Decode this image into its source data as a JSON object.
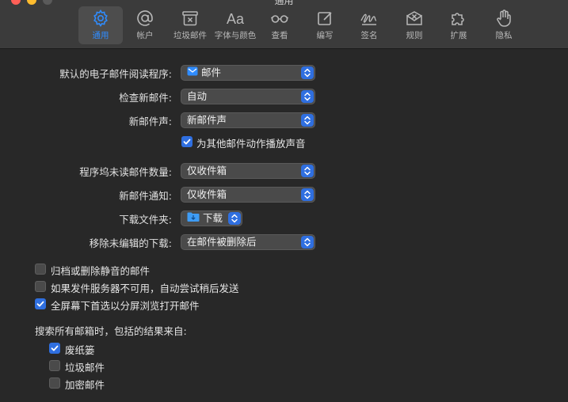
{
  "window": {
    "title": "通用"
  },
  "toolbar": {
    "tabs": [
      {
        "label": "通用",
        "icon": "gear-icon",
        "selected": true
      },
      {
        "label": "帐户",
        "icon": "at-sign-icon"
      },
      {
        "label": "垃圾邮件",
        "icon": "junk-mail-icon"
      },
      {
        "label": "字体与颜色",
        "icon": "fonts-icon",
        "glyph": "Aa"
      },
      {
        "label": "查看",
        "icon": "glasses-icon"
      },
      {
        "label": "编写",
        "icon": "compose-icon"
      },
      {
        "label": "签名",
        "icon": "signature-icon"
      },
      {
        "label": "规则",
        "icon": "rules-icon"
      },
      {
        "label": "扩展",
        "icon": "puzzle-icon"
      },
      {
        "label": "隐私",
        "icon": "hand-icon"
      }
    ]
  },
  "settings": {
    "default_reader": {
      "label": "默认的电子邮件阅读程序:",
      "value": "邮件",
      "icon": "mail-app-icon"
    },
    "check_mail": {
      "label": "检查新邮件:",
      "value": "自动"
    },
    "new_mail_sound": {
      "label": "新邮件声:",
      "value": "新邮件声"
    },
    "play_sounds": {
      "label": "为其他邮件动作播放声音",
      "checked": true
    },
    "dock_unread": {
      "label": "程序坞未读邮件数量:",
      "value": "仅收件箱"
    },
    "new_notifications": {
      "label": "新邮件通知:",
      "value": "仅收件箱"
    },
    "downloads_folder": {
      "label": "下载文件夹:",
      "value": "下载",
      "icon": "downloads-folder-icon"
    },
    "remove_downloads": {
      "label": "移除未编辑的下载:",
      "value": "在邮件被删除后"
    },
    "archive_muted": {
      "label": "归档或删除静音的邮件",
      "checked": false
    },
    "send_later": {
      "label": "如果发件服务器不可用，自动尝试稍后发送",
      "checked": false
    },
    "split_view": {
      "label": "全屏幕下首选以分屏浏览打开邮件",
      "checked": true
    },
    "search_heading": "搜索所有邮箱时，包括的结果来自:",
    "search_trash": {
      "label": "废纸篓",
      "checked": true
    },
    "search_junk": {
      "label": "垃圾邮件",
      "checked": false
    },
    "search_encrypted": {
      "label": "加密邮件",
      "checked": false
    }
  },
  "colors": {
    "accent": "#2f6fe0",
    "selected_tab": "#2f8cff",
    "background": "#282828",
    "toolbar": "#3b3b3b"
  }
}
